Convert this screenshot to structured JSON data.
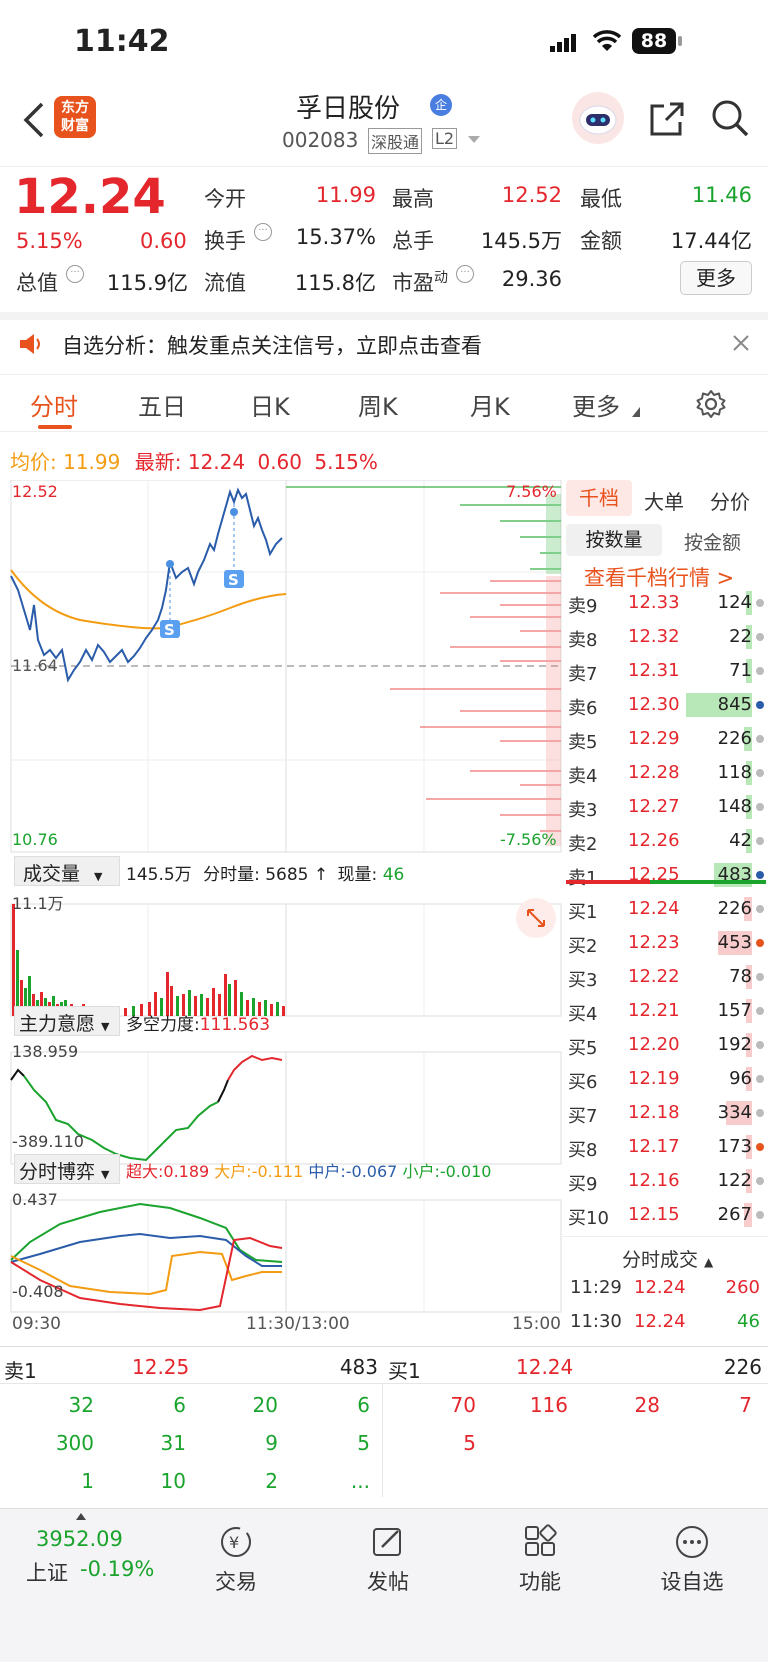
{
  "status_bar": {
    "time": "11:42",
    "battery": "88"
  },
  "header": {
    "title": "孚日股份",
    "badge": "企",
    "code": "002083",
    "tag1": "深股通",
    "tag2": "L2",
    "logo_line1": "东方",
    "logo_line2": "财富"
  },
  "quote": {
    "price": "12.24",
    "change_pct": "5.15%",
    "change": "0.60",
    "open_label": "今开",
    "open": "11.99",
    "high_label": "最高",
    "high": "12.52",
    "low_label": "最低",
    "low": "11.46",
    "turnover_label": "换手",
    "turnover": "15.37%",
    "volume_label": "总手",
    "volume": "145.5万",
    "amount_label": "金额",
    "amount": "17.44亿",
    "mktcap_label": "总值",
    "mktcap": "115.9亿",
    "float_label": "流值",
    "float_cap": "115.8亿",
    "pe_label": "市盈",
    "pe_sup": "动",
    "pe": "29.36",
    "more_button": "更多"
  },
  "notice": {
    "text": "自选分析：触发重点关注信号，立即点击查看"
  },
  "tabs": [
    "分时",
    "五日",
    "日K",
    "周K",
    "月K",
    "更多"
  ],
  "active_tab": 0,
  "price_line": {
    "avg_label": "均价:",
    "avg": "11.99",
    "latest_label": "最新:",
    "latest": "12.24",
    "change": "0.60",
    "change_pct": "5.15%"
  },
  "chart_labels": {
    "top_price": "12.52",
    "bottom_price": "10.76",
    "mid_price": "11.64",
    "top_pct": "7.56%",
    "bottom_pct": "-7.56%",
    "vol_selector": "成交量",
    "vol_total": "145.5万",
    "vol_minute_label": "分时量:",
    "vol_minute": "5685",
    "vol_now_label": "现量:",
    "vol_now": "46",
    "vol_max": "11.1万",
    "ind1_selector": "主力意愿",
    "ind1_label": "多空力度:",
    "ind1_value": "111.563",
    "ind1_top": "138.959",
    "ind1_bottom": "-389.110",
    "ind2_selector": "分时博弈",
    "ind2_super": "超大:0.189",
    "ind2_large": "大户:-0.111",
    "ind2_mid": "中户:-0.067",
    "ind2_small": "小户:-0.010",
    "ind2_top": "0.437",
    "ind2_bottom": "-0.408",
    "time_start": "09:30",
    "time_mid": "11:30/13:00",
    "time_end": "15:00"
  },
  "orderbook": {
    "tab_active": "千档",
    "tab2": "大单",
    "tab3": "分价",
    "sub_active": "按数量",
    "sub2": "按金额",
    "link": "查看千档行情 >",
    "asks": [
      {
        "label": "卖9",
        "price": "12.33",
        "vol": "124",
        "bar": 0.04,
        "dot": "gray"
      },
      {
        "label": "卖8",
        "price": "12.32",
        "vol": "22",
        "bar": 0.02,
        "dot": "gray"
      },
      {
        "label": "卖7",
        "price": "12.31",
        "vol": "71",
        "bar": 0.03,
        "dot": "gray"
      },
      {
        "label": "卖6",
        "price": "12.30",
        "vol": "845",
        "bar": 1.0,
        "dot": "blue"
      },
      {
        "label": "卖5",
        "price": "12.29",
        "vol": "226",
        "bar": 0.12,
        "dot": "gray"
      },
      {
        "label": "卖4",
        "price": "12.28",
        "vol": "118",
        "bar": 0.05,
        "dot": "gray"
      },
      {
        "label": "卖3",
        "price": "12.27",
        "vol": "148",
        "bar": 0.06,
        "dot": "gray"
      },
      {
        "label": "卖2",
        "price": "12.26",
        "vol": "42",
        "bar": 0.02,
        "dot": "gray"
      },
      {
        "label": "卖1",
        "price": "12.25",
        "vol": "483",
        "bar": 0.57,
        "dot": "blue"
      }
    ],
    "bids": [
      {
        "label": "买1",
        "price": "12.24",
        "vol": "226",
        "bar": 0.12,
        "dot": "gray"
      },
      {
        "label": "买2",
        "price": "12.23",
        "vol": "453",
        "bar": 0.52,
        "dot": "orange"
      },
      {
        "label": "买3",
        "price": "12.22",
        "vol": "78",
        "bar": 0.03,
        "dot": "gray"
      },
      {
        "label": "买4",
        "price": "12.21",
        "vol": "157",
        "bar": 0.06,
        "dot": "gray"
      },
      {
        "label": "买5",
        "price": "12.20",
        "vol": "192",
        "bar": 0.08,
        "dot": "gray"
      },
      {
        "label": "买6",
        "price": "12.19",
        "vol": "96",
        "bar": 0.03,
        "dot": "gray"
      },
      {
        "label": "买7",
        "price": "12.18",
        "vol": "334",
        "bar": 0.4,
        "dot": "gray"
      },
      {
        "label": "买8",
        "price": "12.17",
        "vol": "173",
        "bar": 0.08,
        "dot": "orange"
      },
      {
        "label": "买9",
        "price": "12.16",
        "vol": "122",
        "bar": 0.05,
        "dot": "gray"
      },
      {
        "label": "买10",
        "price": "12.15",
        "vol": "267",
        "bar": 0.12,
        "dot": "gray"
      }
    ],
    "trades_title": "分时成交",
    "trades": [
      {
        "time": "11:29",
        "price": "12.24",
        "vol": "260",
        "color": "red"
      },
      {
        "time": "11:30",
        "price": "12.24",
        "vol": "46",
        "color": "green"
      }
    ]
  },
  "bottom_table": {
    "ask_label": "卖1",
    "ask_price": "12.25",
    "ask_vol": "483",
    "bid_label": "买1",
    "bid_price": "12.24",
    "bid_vol": "226",
    "ask_rows": [
      [
        "32",
        "6",
        "20",
        "6"
      ],
      [
        "300",
        "31",
        "9",
        "5"
      ],
      [
        "1",
        "10",
        "2",
        "..."
      ]
    ],
    "bid_rows": [
      [
        "70",
        "116",
        "28",
        "7"
      ],
      [
        "5",
        "",
        "",
        ""
      ],
      [
        "",
        "",
        "",
        ""
      ]
    ]
  },
  "bottom_nav": {
    "index_value": "3952.09",
    "index_name": "上证",
    "index_change": "-0.19%",
    "items": [
      "交易",
      "发帖",
      "功能",
      "设自选"
    ]
  },
  "colors": {
    "red": "#e4262d",
    "green": "#1aa32d",
    "accent": "#e85a16",
    "price_line": "#2a5caa",
    "avg_line": "#f39c12"
  }
}
